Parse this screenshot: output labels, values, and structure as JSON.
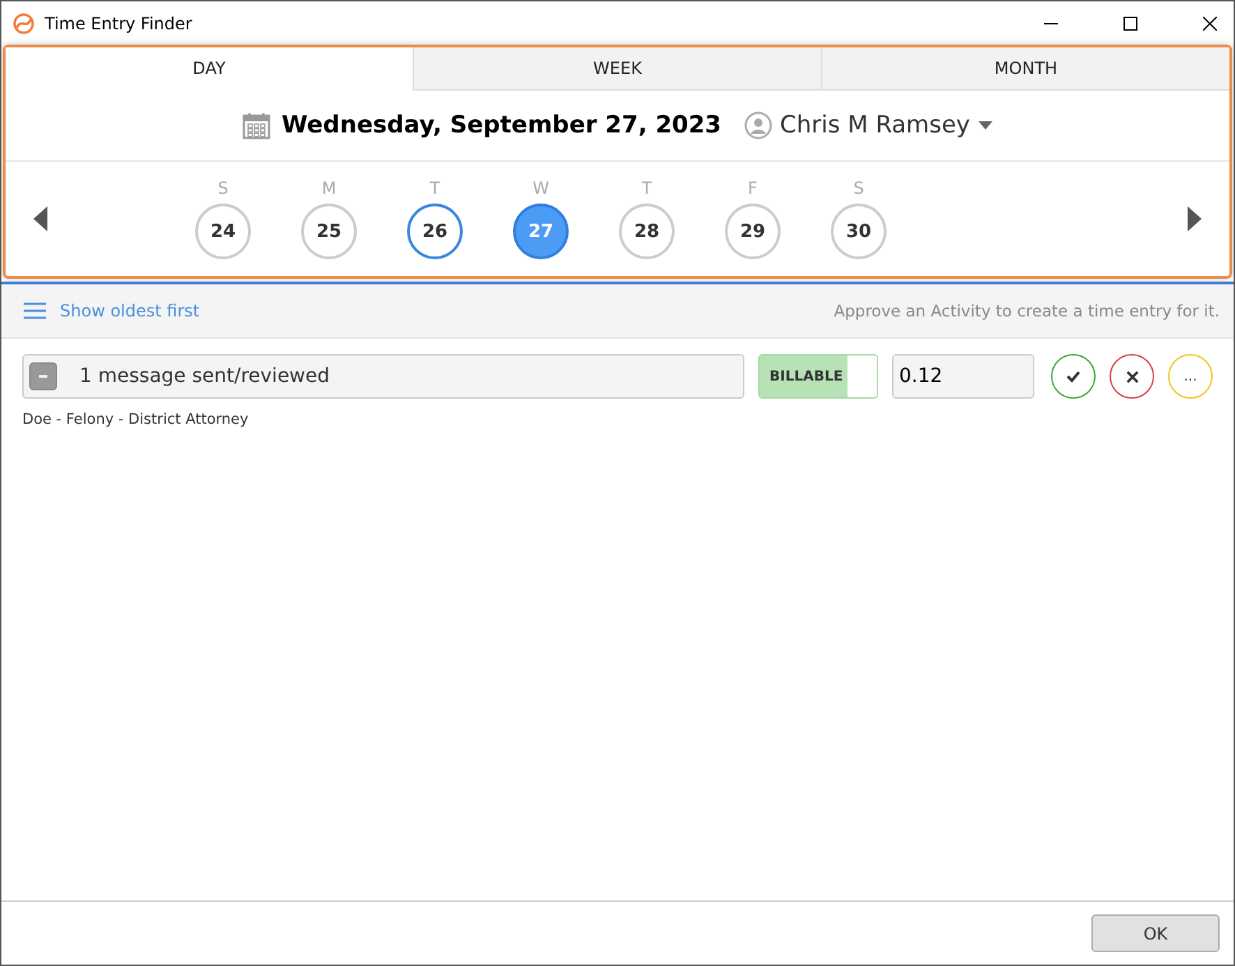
{
  "window": {
    "title": "Time Entry Finder"
  },
  "tabs": [
    {
      "label": "DAY",
      "selected": true
    },
    {
      "label": "WEEK",
      "selected": false
    },
    {
      "label": "MONTH",
      "selected": false
    }
  ],
  "date": "Wednesday, September 27, 2023",
  "user": "Chris M Ramsey",
  "days": [
    {
      "letter": "S",
      "number": "24",
      "selected": false,
      "today": false
    },
    {
      "letter": "M",
      "number": "25",
      "selected": false,
      "today": false
    },
    {
      "letter": "T",
      "number": "26",
      "selected": false,
      "today": true
    },
    {
      "letter": "W",
      "number": "27",
      "selected": true,
      "today": false
    },
    {
      "letter": "T",
      "number": "28",
      "selected": false,
      "today": false
    },
    {
      "letter": "F",
      "number": "29",
      "selected": false,
      "today": false
    },
    {
      "letter": "S",
      "number": "30",
      "selected": false,
      "today": false
    }
  ],
  "toolbar": {
    "sort_link": "Show oldest first",
    "hint": "Approve an Activity to create a time entry for it."
  },
  "entries": [
    {
      "description": "1 message sent/reviewed",
      "billable_label": "BILLABLE",
      "billable": true,
      "hours": "0.12",
      "more": "...",
      "matter": "Doe - Felony - District Attorney"
    }
  ],
  "footer": {
    "ok": "OK"
  }
}
